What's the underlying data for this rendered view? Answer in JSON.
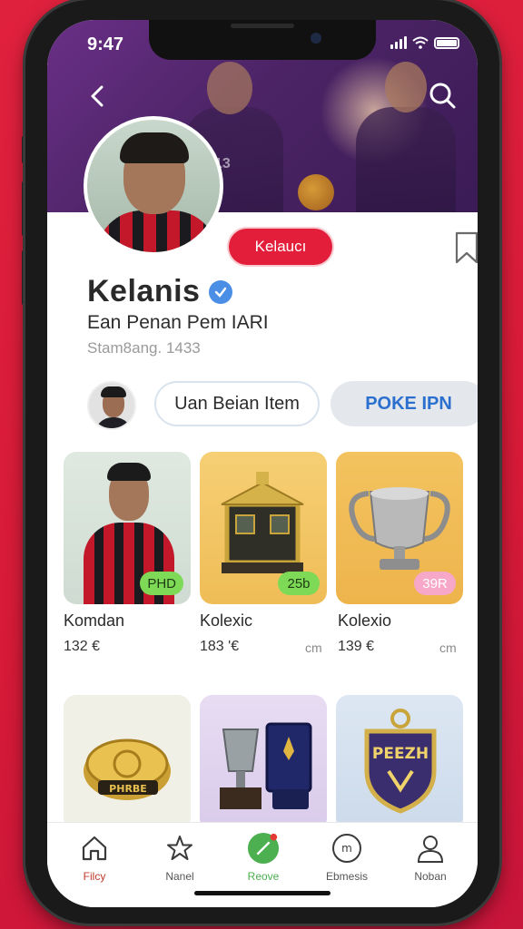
{
  "status": {
    "time": "9:47"
  },
  "profile": {
    "follow_label": "Kelaucı",
    "name": "Kelanis",
    "subtitle": "Ean Penan Pem IARI",
    "meta": "Stam8ang. 1433"
  },
  "actions": {
    "primary_label": "Uan Beian Item",
    "secondary_label": "POKE IPN"
  },
  "items": [
    {
      "title": "Komdan",
      "price": "132 €",
      "unit": "",
      "badge": "PHD",
      "badge_color": "#7ed957"
    },
    {
      "title": "Kolexic",
      "price": "183 '€",
      "unit": "cm",
      "badge": "25b",
      "badge_color": "#7ed957"
    },
    {
      "title": "Kolexio",
      "price": "139 €",
      "unit": "cm",
      "badge": "39R",
      "badge_color": "#f7a8c8"
    }
  ],
  "row2_items": [
    {
      "label": "PHRBE"
    },
    {
      "label": ""
    },
    {
      "label": "PEEZH"
    }
  ],
  "tabs": [
    {
      "label": "Filcy",
      "icon": "home-icon"
    },
    {
      "label": "Nanel",
      "icon": "star-icon"
    },
    {
      "label": "Reove",
      "icon": "edit-icon"
    },
    {
      "label": "Ebmesis",
      "icon": "message-icon"
    },
    {
      "label": "Noban",
      "icon": "profile-icon"
    }
  ],
  "colors": {
    "accent": "#e31e3a",
    "verified": "#4a8ee6",
    "link": "#2b6fcf",
    "hero": "#4c2466"
  }
}
